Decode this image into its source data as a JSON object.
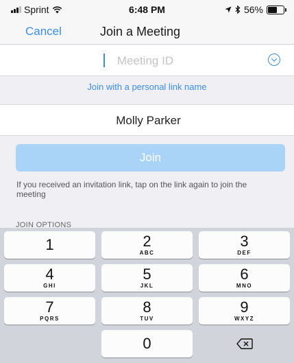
{
  "status": {
    "carrier": "Sprint",
    "time": "6:48 PM",
    "battery": "56%",
    "battery_level": 0.56
  },
  "nav": {
    "cancel": "Cancel",
    "title": "Join a Meeting"
  },
  "meeting_id": {
    "placeholder": "Meeting ID",
    "value": ""
  },
  "personal_link": "Join with a personal link name",
  "name_field": {
    "value": "Molly Parker"
  },
  "join_button": "Join",
  "hint": "If you received an invitation link, tap on the link again to join the meeting",
  "join_options": "JOIN OPTIONS",
  "keypad": [
    {
      "digit": "1",
      "letters": ""
    },
    {
      "digit": "2",
      "letters": "ABC"
    },
    {
      "digit": "3",
      "letters": "DEF"
    },
    {
      "digit": "4",
      "letters": "GHI"
    },
    {
      "digit": "5",
      "letters": "JKL"
    },
    {
      "digit": "6",
      "letters": "MNO"
    },
    {
      "digit": "7",
      "letters": "PQRS"
    },
    {
      "digit": "8",
      "letters": "TUV"
    },
    {
      "digit": "9",
      "letters": "WXYZ"
    },
    {
      "digit": "0",
      "letters": ""
    }
  ],
  "colors": {
    "accent": "#3a8ee6",
    "join_disabled": "#a9d3f7",
    "keypad_bg": "#d1d5db"
  },
  "icons": {
    "dropdown": "chevron-circle-down-icon",
    "backspace": "backspace-icon"
  }
}
